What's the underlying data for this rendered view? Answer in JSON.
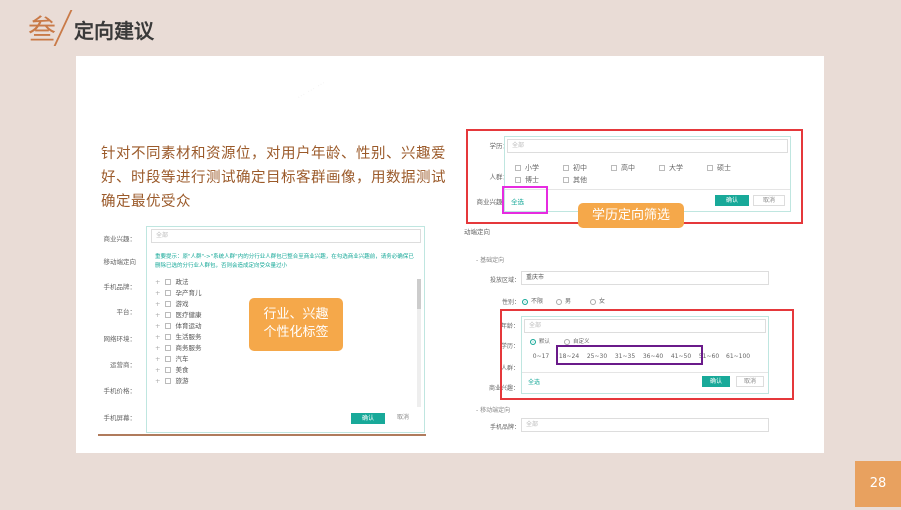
{
  "slide": {
    "title_char": "叁",
    "title": "定向建议",
    "page_number": "28",
    "description": "针对不同素材和资源位，对用户年龄、性别、兴趣爱好、时段等进行测试确定目标客群画像，用数据测试确定最优受众"
  },
  "left_panel": {
    "side_labels": [
      "商业兴趣：",
      "移动端定向",
      "手机品牌：",
      "平台：",
      "网络环境：",
      "运营商：",
      "手机价格：",
      "手机屏幕："
    ],
    "interest_placeholder": "全部",
    "notice": "重要提示：原\"人群\"->\"系统人群\"内的分行业人群包已整合至商业兴趣，在勾选商业兴趣前，请务必确保已删除已选的分行业人群包，否则会造成定向受众量过小",
    "tree_items": [
      "政法",
      "孕产育儿",
      "游戏",
      "医疗健康",
      "体育运动",
      "生活服务",
      "商务服务",
      "汽车",
      "美食",
      "旅游"
    ],
    "confirm": "确认",
    "cancel": "取消",
    "tag_label": "行业、兴趣个性化标签"
  },
  "right_top_panel": {
    "education_label": "学历：",
    "education_placeholder": "全部",
    "crowd_label": "人群：",
    "interest_label": "商业兴趣：",
    "options": [
      "小学",
      "初中",
      "高中",
      "大学",
      "硕士",
      "博士",
      "其他"
    ],
    "select_all": "全选",
    "confirm": "确认",
    "cancel": "取消",
    "tag_label": "学历定向筛选",
    "below_text": "动端定向"
  },
  "right_bottom_panel": {
    "section_basic": "基础定向",
    "region_label": "投放区域：",
    "region_value": "重庆市",
    "gender_label": "性别：",
    "gender_options": [
      "不限",
      "男",
      "女"
    ],
    "age_label": "年龄：",
    "age_placeholder": "全部",
    "education_label": "学历：",
    "age_mode_options": [
      "默认",
      "自定义"
    ],
    "crowd_label": "人群：",
    "ages": [
      "0~17",
      "18~24",
      "25~30",
      "31~35",
      "36~40",
      "41~50",
      "51~60",
      "61~100"
    ],
    "select_all": "全选",
    "interest_label": "商业兴趣：",
    "confirm": "确认",
    "cancel": "取消",
    "section_mobile": "移动端定向",
    "phone_brand_label": "手机品牌：",
    "phone_brand_placeholder": "全部"
  },
  "colors": {
    "accent": "#c97a48",
    "teal": "#18a999",
    "highlight_red": "#e5383b",
    "highlight_magenta": "#e62be0",
    "highlight_purple": "#6a1a8a",
    "tag_orange": "#f5a84a"
  }
}
